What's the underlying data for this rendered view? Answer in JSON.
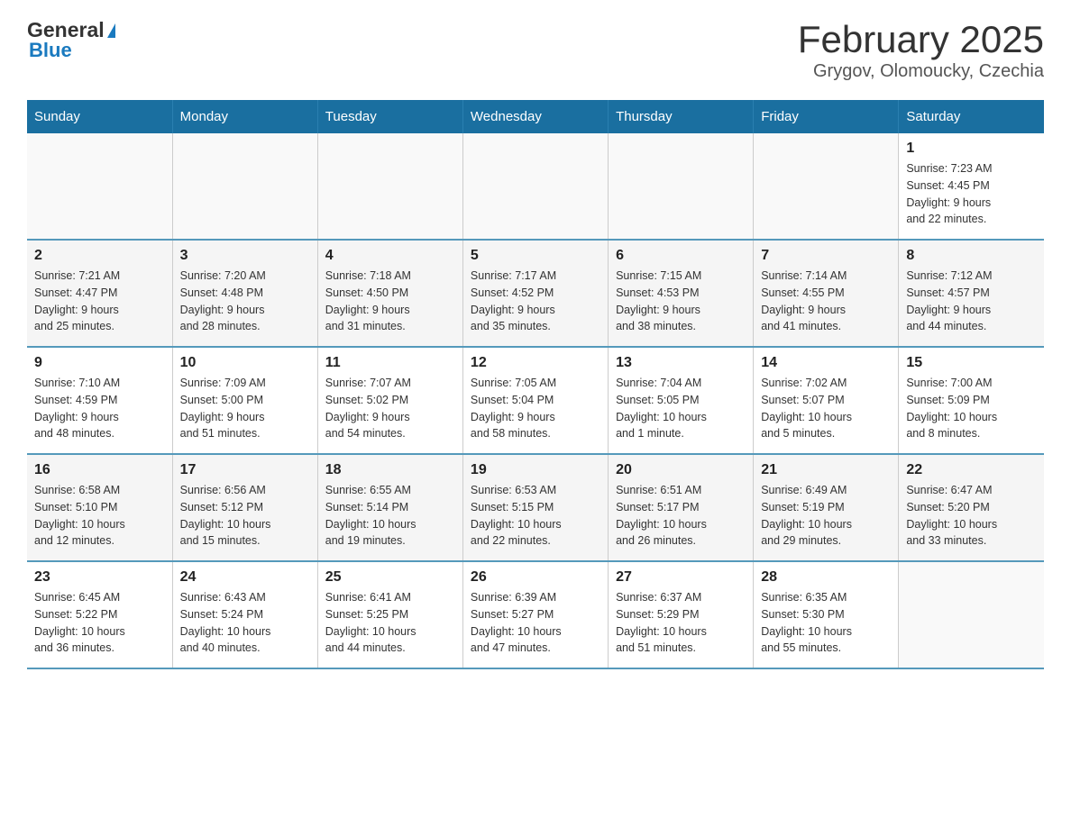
{
  "logo": {
    "general": "General",
    "triangle": "▶",
    "blue": "Blue"
  },
  "title": "February 2025",
  "subtitle": "Grygov, Olomoucky, Czechia",
  "days_of_week": [
    "Sunday",
    "Monday",
    "Tuesday",
    "Wednesday",
    "Thursday",
    "Friday",
    "Saturday"
  ],
  "weeks": [
    [
      {
        "day": "",
        "info": ""
      },
      {
        "day": "",
        "info": ""
      },
      {
        "day": "",
        "info": ""
      },
      {
        "day": "",
        "info": ""
      },
      {
        "day": "",
        "info": ""
      },
      {
        "day": "",
        "info": ""
      },
      {
        "day": "1",
        "info": "Sunrise: 7:23 AM\nSunset: 4:45 PM\nDaylight: 9 hours\nand 22 minutes."
      }
    ],
    [
      {
        "day": "2",
        "info": "Sunrise: 7:21 AM\nSunset: 4:47 PM\nDaylight: 9 hours\nand 25 minutes."
      },
      {
        "day": "3",
        "info": "Sunrise: 7:20 AM\nSunset: 4:48 PM\nDaylight: 9 hours\nand 28 minutes."
      },
      {
        "day": "4",
        "info": "Sunrise: 7:18 AM\nSunset: 4:50 PM\nDaylight: 9 hours\nand 31 minutes."
      },
      {
        "day": "5",
        "info": "Sunrise: 7:17 AM\nSunset: 4:52 PM\nDaylight: 9 hours\nand 35 minutes."
      },
      {
        "day": "6",
        "info": "Sunrise: 7:15 AM\nSunset: 4:53 PM\nDaylight: 9 hours\nand 38 minutes."
      },
      {
        "day": "7",
        "info": "Sunrise: 7:14 AM\nSunset: 4:55 PM\nDaylight: 9 hours\nand 41 minutes."
      },
      {
        "day": "8",
        "info": "Sunrise: 7:12 AM\nSunset: 4:57 PM\nDaylight: 9 hours\nand 44 minutes."
      }
    ],
    [
      {
        "day": "9",
        "info": "Sunrise: 7:10 AM\nSunset: 4:59 PM\nDaylight: 9 hours\nand 48 minutes."
      },
      {
        "day": "10",
        "info": "Sunrise: 7:09 AM\nSunset: 5:00 PM\nDaylight: 9 hours\nand 51 minutes."
      },
      {
        "day": "11",
        "info": "Sunrise: 7:07 AM\nSunset: 5:02 PM\nDaylight: 9 hours\nand 54 minutes."
      },
      {
        "day": "12",
        "info": "Sunrise: 7:05 AM\nSunset: 5:04 PM\nDaylight: 9 hours\nand 58 minutes."
      },
      {
        "day": "13",
        "info": "Sunrise: 7:04 AM\nSunset: 5:05 PM\nDaylight: 10 hours\nand 1 minute."
      },
      {
        "day": "14",
        "info": "Sunrise: 7:02 AM\nSunset: 5:07 PM\nDaylight: 10 hours\nand 5 minutes."
      },
      {
        "day": "15",
        "info": "Sunrise: 7:00 AM\nSunset: 5:09 PM\nDaylight: 10 hours\nand 8 minutes."
      }
    ],
    [
      {
        "day": "16",
        "info": "Sunrise: 6:58 AM\nSunset: 5:10 PM\nDaylight: 10 hours\nand 12 minutes."
      },
      {
        "day": "17",
        "info": "Sunrise: 6:56 AM\nSunset: 5:12 PM\nDaylight: 10 hours\nand 15 minutes."
      },
      {
        "day": "18",
        "info": "Sunrise: 6:55 AM\nSunset: 5:14 PM\nDaylight: 10 hours\nand 19 minutes."
      },
      {
        "day": "19",
        "info": "Sunrise: 6:53 AM\nSunset: 5:15 PM\nDaylight: 10 hours\nand 22 minutes."
      },
      {
        "day": "20",
        "info": "Sunrise: 6:51 AM\nSunset: 5:17 PM\nDaylight: 10 hours\nand 26 minutes."
      },
      {
        "day": "21",
        "info": "Sunrise: 6:49 AM\nSunset: 5:19 PM\nDaylight: 10 hours\nand 29 minutes."
      },
      {
        "day": "22",
        "info": "Sunrise: 6:47 AM\nSunset: 5:20 PM\nDaylight: 10 hours\nand 33 minutes."
      }
    ],
    [
      {
        "day": "23",
        "info": "Sunrise: 6:45 AM\nSunset: 5:22 PM\nDaylight: 10 hours\nand 36 minutes."
      },
      {
        "day": "24",
        "info": "Sunrise: 6:43 AM\nSunset: 5:24 PM\nDaylight: 10 hours\nand 40 minutes."
      },
      {
        "day": "25",
        "info": "Sunrise: 6:41 AM\nSunset: 5:25 PM\nDaylight: 10 hours\nand 44 minutes."
      },
      {
        "day": "26",
        "info": "Sunrise: 6:39 AM\nSunset: 5:27 PM\nDaylight: 10 hours\nand 47 minutes."
      },
      {
        "day": "27",
        "info": "Sunrise: 6:37 AM\nSunset: 5:29 PM\nDaylight: 10 hours\nand 51 minutes."
      },
      {
        "day": "28",
        "info": "Sunrise: 6:35 AM\nSunset: 5:30 PM\nDaylight: 10 hours\nand 55 minutes."
      },
      {
        "day": "",
        "info": ""
      }
    ]
  ]
}
